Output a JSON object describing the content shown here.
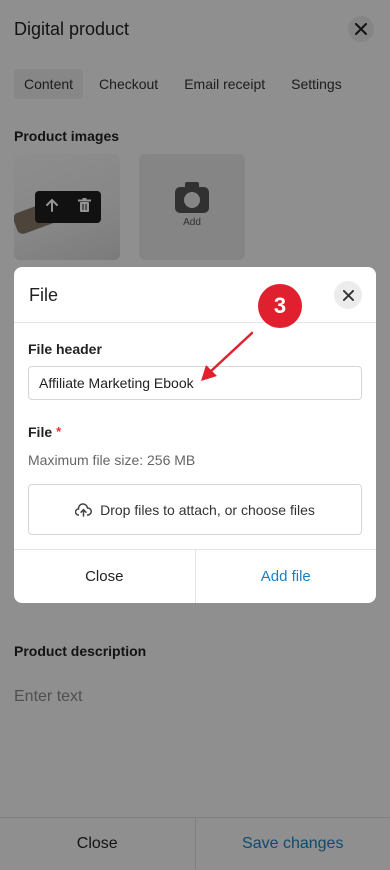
{
  "page": {
    "title": "Digital product",
    "tabs": [
      "Content",
      "Checkout",
      "Email receipt",
      "Settings"
    ],
    "product_images_label": "Product images",
    "add_label": "Add",
    "description_label": "Product description",
    "description_placeholder": "Enter text",
    "footer": {
      "close": "Close",
      "save": "Save changes"
    }
  },
  "modal": {
    "title": "File",
    "file_header_label": "File header",
    "file_header_value": "Affiliate Marketing Ebook",
    "file_label": "File",
    "required_mark": "*",
    "max_size_hint": "Maximum file size: 256 MB",
    "dropzone_text": "Drop files to attach, or choose files",
    "close_label": "Close",
    "add_label": "Add file"
  },
  "annotation": {
    "step": "3"
  },
  "colors": {
    "accent": "#1a7fc1",
    "badge": "#e0202f",
    "required": "#e0323a"
  },
  "icons": [
    "close-icon",
    "upload-arrow-icon",
    "trash-icon",
    "camera-icon",
    "cloud-upload-icon"
  ]
}
